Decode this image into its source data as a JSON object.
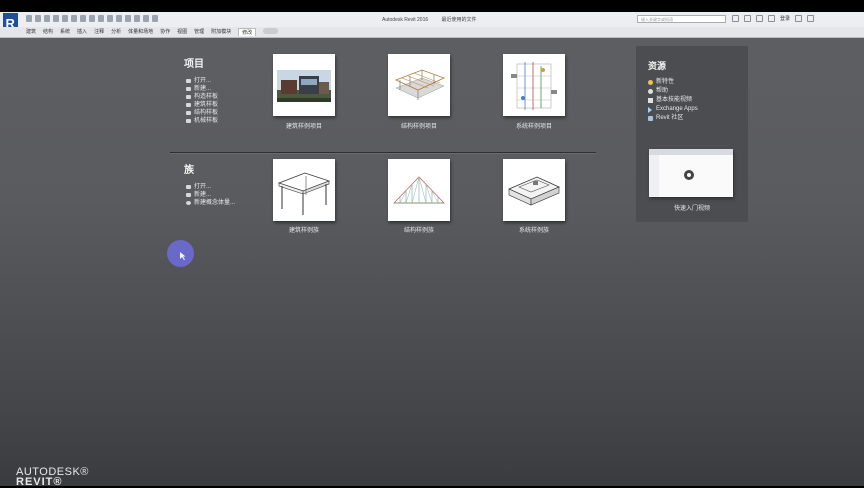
{
  "window": {
    "title": "Autodesk Revit 2016",
    "subtitle": "最近使用的文件",
    "search_placeholder": "键入关键字或短语",
    "user_label": "登录"
  },
  "ribbon": {
    "tabs": [
      "建筑",
      "结构",
      "系统",
      "插入",
      "注释",
      "分析",
      "体量和场地",
      "协作",
      "视图",
      "管理",
      "附加模块",
      "修改"
    ],
    "active_tab": "修改"
  },
  "projects": {
    "title": "项目",
    "links": [
      "打开...",
      "新建...",
      "构造样板",
      "建筑样板",
      "结构样板",
      "机械样板"
    ],
    "cards": [
      "建筑样例项目",
      "结构样例项目",
      "系统样例项目"
    ]
  },
  "families": {
    "title": "族",
    "links": [
      "打开...",
      "新建...",
      "新建概念体量..."
    ],
    "cards": [
      "建筑样例族",
      "结构样例族",
      "系统样例族"
    ]
  },
  "resources": {
    "title": "资源",
    "links": [
      "新特性",
      "帮助",
      "基本技能视频",
      "Exchange Apps",
      "Revit 社区"
    ],
    "video_caption": "快速入门视频"
  },
  "brand": {
    "company": "AUTODESK®",
    "product": "REVIT®"
  },
  "colors": {
    "background_top": "#5e5f63",
    "background_bottom": "#3a3b3e",
    "cursor_highlight": "#6c6bd0"
  }
}
